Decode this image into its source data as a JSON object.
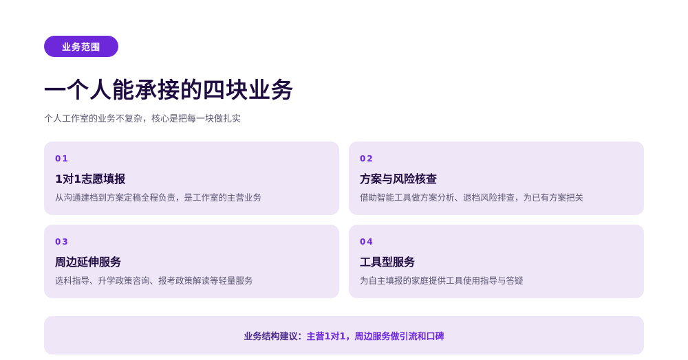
{
  "badge": "业务范围",
  "title": "一个人能承接的四块业务",
  "subtitle": "个人工作室的业务不复杂，核心是把每一块做扎实",
  "cards": [
    {
      "num": "01",
      "title": "1对1志愿填报",
      "desc": "从沟通建档到方案定稿全程负责，是工作室的主营业务"
    },
    {
      "num": "02",
      "title": "方案与风险核查",
      "desc": "借助智能工具做方案分析、退档风险排查，为已有方案把关"
    },
    {
      "num": "03",
      "title": "周边延伸服务",
      "desc": "选科指导、升学政策咨询、报考政策解读等轻量服务"
    },
    {
      "num": "04",
      "title": "工具型服务",
      "desc": "为自主填报的家庭提供工具使用指导与答疑"
    }
  ],
  "note": {
    "label": "业务结构建议：",
    "value": "主营1对1，周边服务做引流和口碑"
  },
  "colors": {
    "accent": "#6d28d9",
    "card_bg": "#efe7f8",
    "title_text": "#1e0b40",
    "body_text": "#5a5570"
  }
}
